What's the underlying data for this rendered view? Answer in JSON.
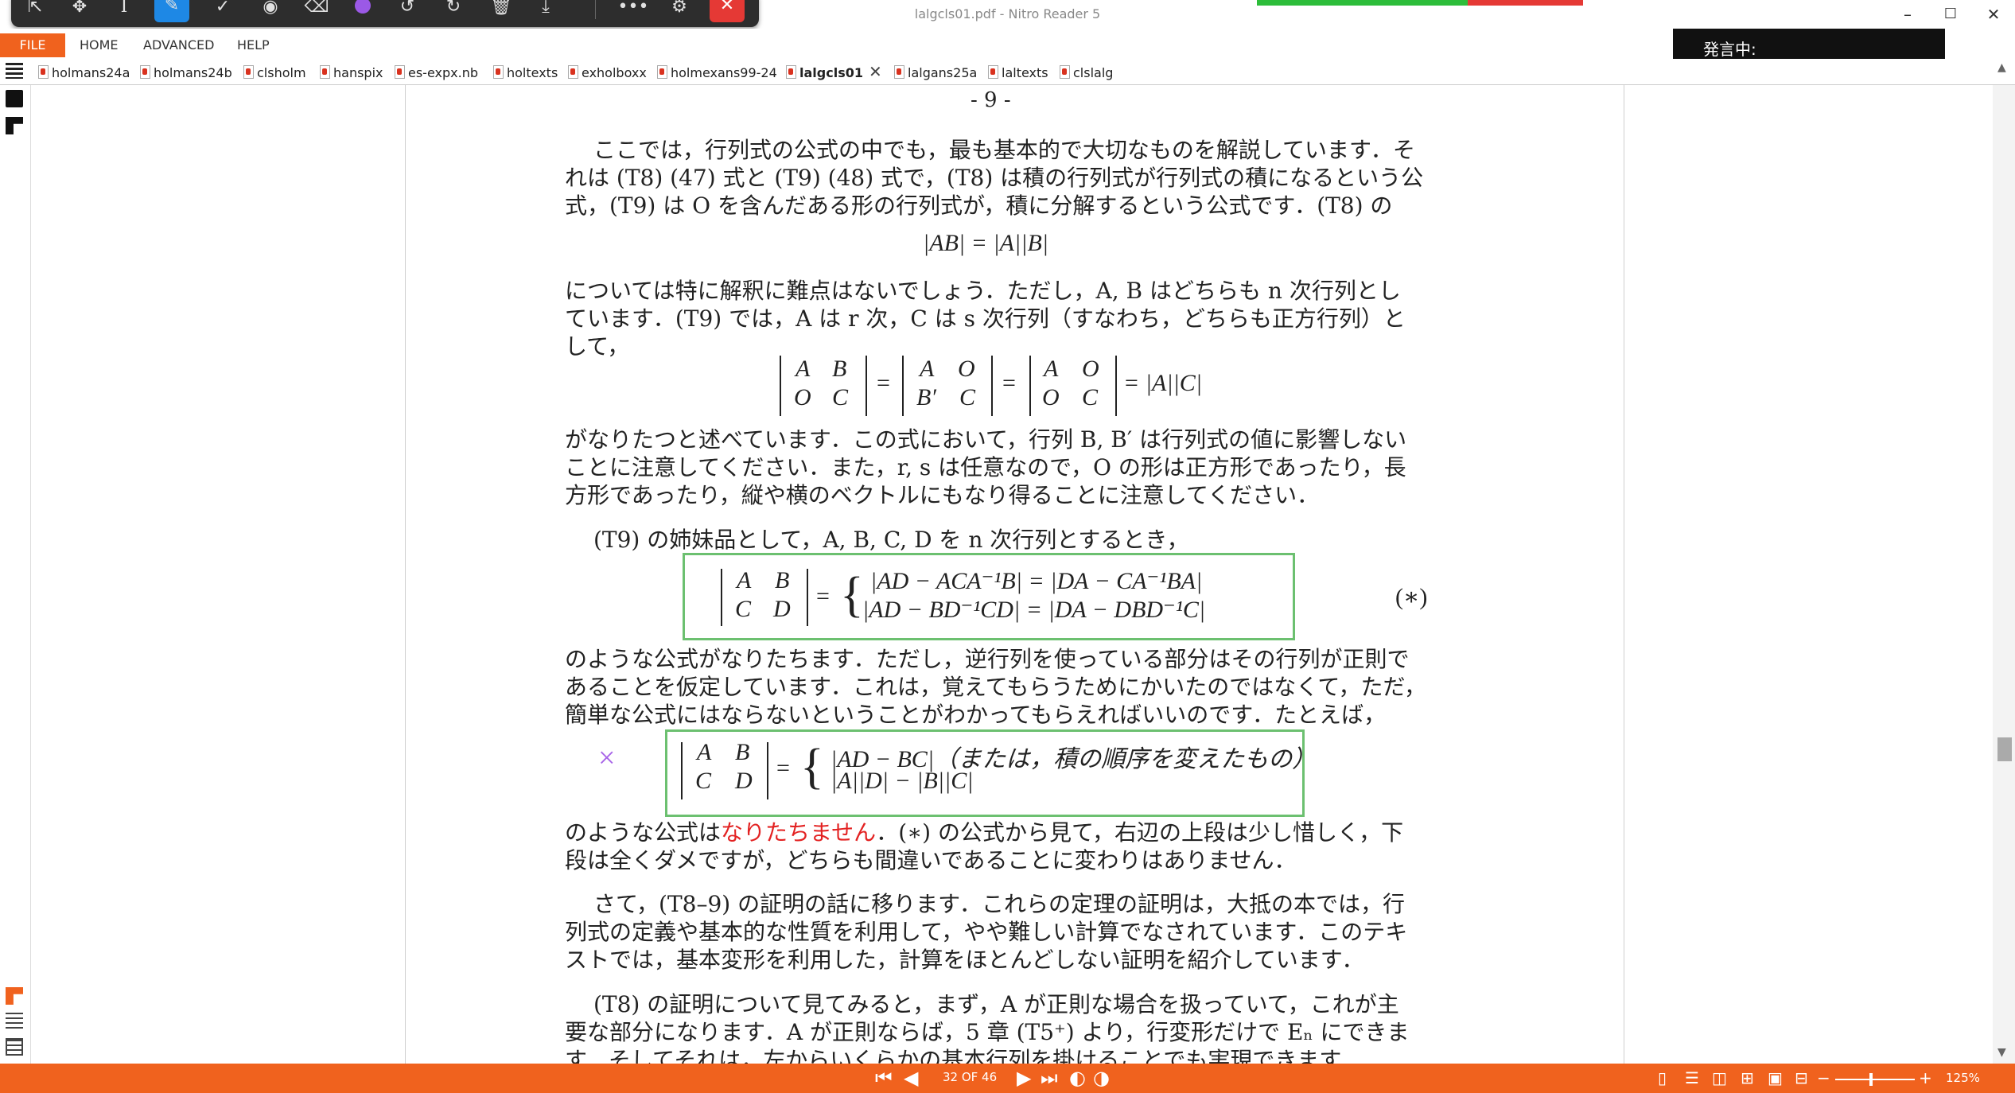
{
  "window": {
    "title": "lalgcls01.pdf - Nitro Reader 5"
  },
  "menus": [
    "FILE",
    "HOME",
    "ADVANCED",
    "HELP"
  ],
  "speech_label": "発言中:",
  "tabs": [
    "holmans24a",
    "holmans24b",
    "clsholm",
    "hanspix",
    "es-expx.nb",
    "holtexts",
    "exholboxx",
    "holmexans99-24",
    "lalgcls01",
    "lalgans25a",
    "laltexts",
    "clslalg"
  ],
  "active_tab": "lalgcls01",
  "document": {
    "page_number": "- 9 -",
    "p1": [
      "ここでは，行列式の公式の中でも，最も基本的で大切なものを解説しています．そ",
      "れは (T8) (47) 式と (T9) (48) 式で，(T8) は積の行列式が行列式の積になるという公",
      "式，(T9) は O を含んだある形の行列式が，積に分解するという公式です．(T8) の"
    ],
    "eq1": "|AB| = |A||B|",
    "p2": [
      "については特に解釈に難点はないでしょう．ただし，A, B はどちらも n 次行列とし",
      "ています．(T9) では，A は r 次，C は s 次行列（すなわち，どちらも正方行列）と",
      "して，"
    ],
    "eq2": {
      "m1": [
        "A",
        "B",
        "O",
        "C"
      ],
      "m2": [
        "A",
        "O",
        "B′",
        "C"
      ],
      "m3": [
        "A",
        "O",
        "O",
        "C"
      ],
      "eq": "=",
      "rhs": "= |A||C|"
    },
    "p3": [
      "がなりたつと述べています．この式において，行列 B, B′ は行列式の値に影響しない",
      "ことに注意してください．また，r, s は任意なので，O の形は正方形であったり，長",
      "方形であったり，縦や横のベクトルにもなり得ることに注意してください．"
    ],
    "p4": "(T9) の姉妹品として，A, B, C, D を n 次行列とするとき，",
    "eq3": {
      "m": [
        "A",
        "B",
        "C",
        "D"
      ],
      "line1": "|AD − ACA⁻¹B| = |DA − CA⁻¹BA|",
      "line2": "|AD − BD⁻¹CD| = |DA − DBD⁻¹C|",
      "tag": "(∗)"
    },
    "p5": [
      "のような公式がなりたちます．ただし，逆行列を使っている部分はその行列が正則で",
      "あることを仮定しています．これは，覚えてもらうためにかいたのではなくて，ただ，",
      "簡単な公式にはならないということがわかってもらえればいいのです．たとえば，"
    ],
    "eq4": {
      "m": [
        "A",
        "B",
        "C",
        "D"
      ],
      "line1": "|AD − BC|（または，積の順序を変えたもの）",
      "line2": "|A||D| − |B||C|",
      "mark": "×"
    },
    "p6a_pre": "のような公式は",
    "p6a_red": "なりたちません",
    "p6a_post": "．(∗) の公式から見て，右辺の上段は少し惜しく，下",
    "p6b": "段は全くダメですが，どちらも間違いであることに変わりはありません．",
    "p7": [
      "さて，(T8–9) の証明の話に移ります．これらの定理の証明は，大抵の本では，行",
      "列式の定義や基本的な性質を利用して，やや難しい計算でなされています．このテキ",
      "ストでは，基本変形を利用した，計算をほとんどしない証明を紹介しています．"
    ],
    "p8": [
      "(T8) の証明について見てみると，まず，A が正則な場合を扱っていて，これが主",
      "要な部分になります．A が正則ならば，5 章 (T5⁺) より，行変形だけで Eₙ にできま",
      "す．そしてそれは，左からいくらかの基本行列を掛けることでも実現できます．"
    ]
  },
  "status": {
    "page_indicator": "32 OF 46",
    "zoom": "125%"
  },
  "colors": {
    "accent": "#f0621e",
    "box": "#6cc070",
    "red_text": "#e32222"
  }
}
